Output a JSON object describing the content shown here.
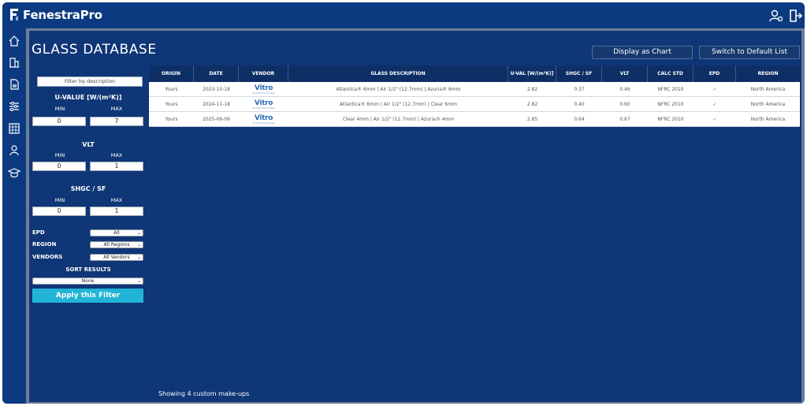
{
  "app": {
    "brand": "FenestraPro"
  },
  "header": {
    "icons": [
      "user-settings-icon",
      "logout-icon"
    ]
  },
  "sidebar": {
    "icons": [
      "home-icon",
      "building-icon",
      "document-icon",
      "sliders-icon",
      "grid-icon",
      "person-icon",
      "graduation-cap-icon"
    ]
  },
  "page": {
    "title": "GLASS DATABASE",
    "display_chart_label": "Display as Chart",
    "switch_default_label": "Switch to Default List",
    "footer_count": "Showing 4 custom make-ups"
  },
  "filters": {
    "description_placeholder": "Filter by description",
    "uvalue": {
      "heading": "U-VALUE [W/(m²K)]",
      "min_label": "MIN",
      "max_label": "MAX",
      "min": "0",
      "max": "7"
    },
    "vlt": {
      "heading": "VLT",
      "min_label": "MIN",
      "max_label": "MAX",
      "min": "0",
      "max": "1"
    },
    "shgc": {
      "heading": "SHGC / SF",
      "min_label": "MIN",
      "max_label": "MAX",
      "min": "0",
      "max": "1"
    },
    "epd": {
      "label": "EPD",
      "value": "All"
    },
    "region": {
      "label": "REGION",
      "value": "All Regions"
    },
    "vendors": {
      "label": "VENDORS",
      "value": "All Vendors"
    },
    "sort": {
      "label": "SORT RESULTS",
      "value": "None"
    },
    "apply_label": "Apply this Filter"
  },
  "table": {
    "columns": [
      "ORIGIN",
      "DATE",
      "VENDOR",
      "GLASS DESCRIPTION",
      "U-VAL [W/(m²K)]",
      "SHGC / SF",
      "VLT",
      "CALC STD",
      "EPD",
      "REGION"
    ],
    "rows": [
      {
        "origin": "Yours",
        "date": "2023-10-18",
        "vendor": "Vitro",
        "vendor_sub": "Architectural Glass",
        "description": "Atlantica® 6mm | Air 1/2\" (12.7mm) | Azuria® 6mm",
        "uval": "2.82",
        "shgc": "0.37",
        "vlt": "0.46",
        "calc_std": "NFRC 2010",
        "epd": "✓",
        "region": "North America"
      },
      {
        "origin": "Yours",
        "date": "2024-11-18",
        "vendor": "Vitro",
        "vendor_sub": "Architectural Glass",
        "description": "Atlantica® 6mm | Air 1/2\" (12.7mm) | Clear 6mm",
        "uval": "2.82",
        "shgc": "0.40",
        "vlt": "0.60",
        "calc_std": "NFRC 2010",
        "epd": "✓",
        "region": "North America"
      },
      {
        "origin": "Yours",
        "date": "2025-06-06",
        "vendor": "Vitro",
        "vendor_sub": "Architectural Glass",
        "description": "Clear 4mm | Air 1/2\" (12.7mm) | Azuria® 4mm",
        "uval": "2.85",
        "shgc": "0.64",
        "vlt": "0.67",
        "calc_std": "NFRC 2010",
        "epd": "✓",
        "region": "North America"
      }
    ]
  },
  "colors": {
    "background": "#0f3676",
    "topbar": "#0c3a80",
    "accent": "#22b4d6",
    "table_header": "#0d2f66"
  }
}
